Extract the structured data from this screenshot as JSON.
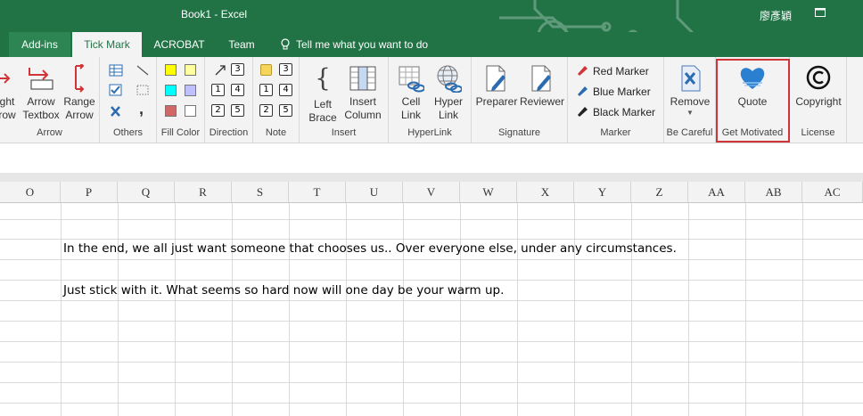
{
  "window": {
    "title": "Book1  -  Excel",
    "user": "廖彥穎"
  },
  "tabs": {
    "addins": "Add-ins",
    "tickmark": "Tick Mark",
    "acrobat": "ACROBAT",
    "team": "Team",
    "tell_me": "Tell me what you want to do"
  },
  "ribbon": {
    "arrow_group": {
      "label": "Arrow",
      "buttons": [
        "ght\nrow",
        "Arrow\nTextbox",
        "Range\nArrow"
      ],
      "b1l1": "ght",
      "b1l2": "row",
      "b2l1": "Arrow",
      "b2l2": "Textbox",
      "b3l1": "Range",
      "b3l2": "Arrow"
    },
    "others_group": {
      "label": "Others"
    },
    "fill_color_group": {
      "label": "Fill Color",
      "colors": [
        "#ffff00",
        "#ffffa0",
        "#00ffff",
        "#c0c0ff",
        "#d06868",
        "#ffffff"
      ]
    },
    "direction_group": {
      "label": "Direction",
      "numbers": [
        "3",
        "1",
        "4",
        "2",
        "5"
      ]
    },
    "note_group": {
      "label": "Note",
      "numbers": [
        "3",
        "1",
        "4",
        "2",
        "5"
      ]
    },
    "insert_group": {
      "label": "Insert",
      "left_brace_l1": "Left",
      "left_brace_l2": "Brace",
      "insert_column_l1": "Insert",
      "insert_column_l2": "Column"
    },
    "hyperlink_group": {
      "label": "HyperLink",
      "cell_link_l1": "Cell",
      "cell_link_l2": "Link",
      "hyper_link_l1": "Hyper",
      "hyper_link_l2": "Link"
    },
    "signature_group": {
      "label": "Signature",
      "preparer": "Preparer",
      "reviewer": "Reviewer"
    },
    "marker_group": {
      "label": "Marker",
      "red": "Red Marker",
      "blue": "Blue Marker",
      "black": "Black Marker"
    },
    "be_careful_group": {
      "label": "Be Careful",
      "remove": "Remove"
    },
    "get_motivated_group": {
      "label": "Get Motivated",
      "quote": "Quote"
    },
    "license_group": {
      "label": "License",
      "copyright": "Copyright"
    }
  },
  "sheet": {
    "columns": [
      "O",
      "P",
      "Q",
      "R",
      "S",
      "T",
      "U",
      "V",
      "W",
      "X",
      "Y",
      "Z",
      "AA",
      "AB",
      "AC"
    ],
    "cells": [
      "In the end, we all just want someone that chooses us.. Over everyone else, under any circumstances.",
      "Just stick with it. What seems so hard now will one day be your warm up."
    ]
  },
  "colors": {
    "accent": "#217346",
    "highlight_border": "#d13438",
    "heart": "#2b7fd1"
  }
}
